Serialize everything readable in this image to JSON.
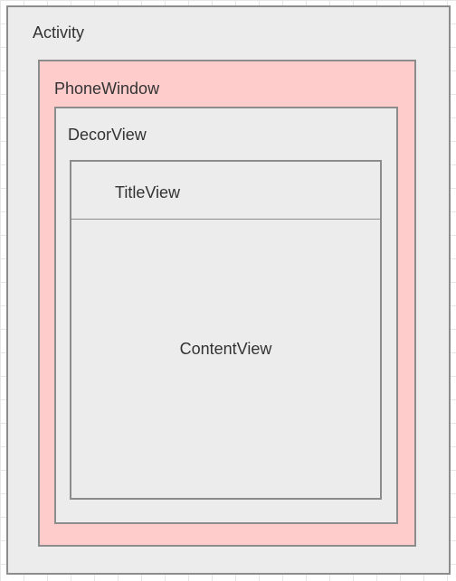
{
  "diagram": {
    "activity": {
      "label": "Activity"
    },
    "phone_window": {
      "label": "PhoneWindow"
    },
    "decor_view": {
      "label": "DecorView"
    },
    "title_view": {
      "label": "TitleView"
    },
    "content_view": {
      "label": "ContentView"
    }
  },
  "colors": {
    "background": "#ffffff",
    "grid": "#e6e6e6",
    "box_fill": "#ececec",
    "phone_window_fill": "#ffcccc",
    "border": "#8c8c8c",
    "text": "#333333"
  }
}
